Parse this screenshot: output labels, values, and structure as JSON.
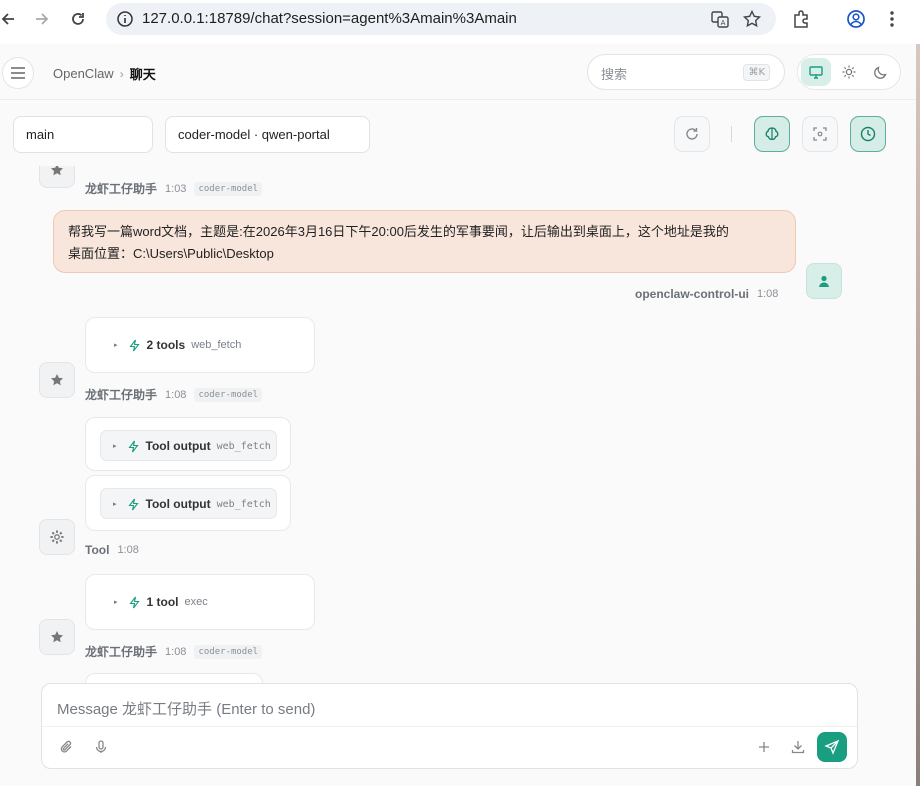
{
  "browser": {
    "url": "127.0.0.1:18789/chat?session=agent%3Amain%3Amain"
  },
  "header": {
    "breadcrumb_root": "OpenClaw",
    "breadcrumb_sep": "›",
    "breadcrumb_current": "聊天",
    "search_placeholder": "搜索",
    "search_shortcut": "⌘K",
    "accent_color": "#1a9e80"
  },
  "toolbar": {
    "agent_select": "main",
    "model_select": "coder-model · qwen-portal"
  },
  "messages": {
    "top_meta": {
      "sender": "龙虾工仔助手",
      "time": "1:03",
      "model": "coder-model"
    },
    "user": {
      "line1": "帮我写一篇word文档，主题是:在2026年3月16日下午20:00后发生的军事要闻，让后输出到桌面上，这个地址是我的",
      "line2": "桌面位置：C:\\Users\\Public\\Desktop",
      "sender": "openclaw-control-ui",
      "time": "1:08"
    },
    "assistant1": {
      "tools_label": "2 tools",
      "tools_sub": "web_fetch",
      "sender": "龙虾工仔助手",
      "time": "1:08",
      "model": "coder-model"
    },
    "tool_outputs": {
      "out1_label": "Tool output",
      "out1_sub": "web_fetch",
      "out2_label": "Tool output",
      "out2_sub": "web_fetch",
      "sender": "Tool",
      "time": "1:08"
    },
    "assistant2": {
      "tools_label": "1 tool",
      "tools_sub": "exec",
      "sender": "龙虾工仔助手",
      "time": "1:08",
      "model": "coder-model"
    }
  },
  "composer": {
    "placeholder": "Message 龙虾工仔助手 (Enter to send)"
  }
}
